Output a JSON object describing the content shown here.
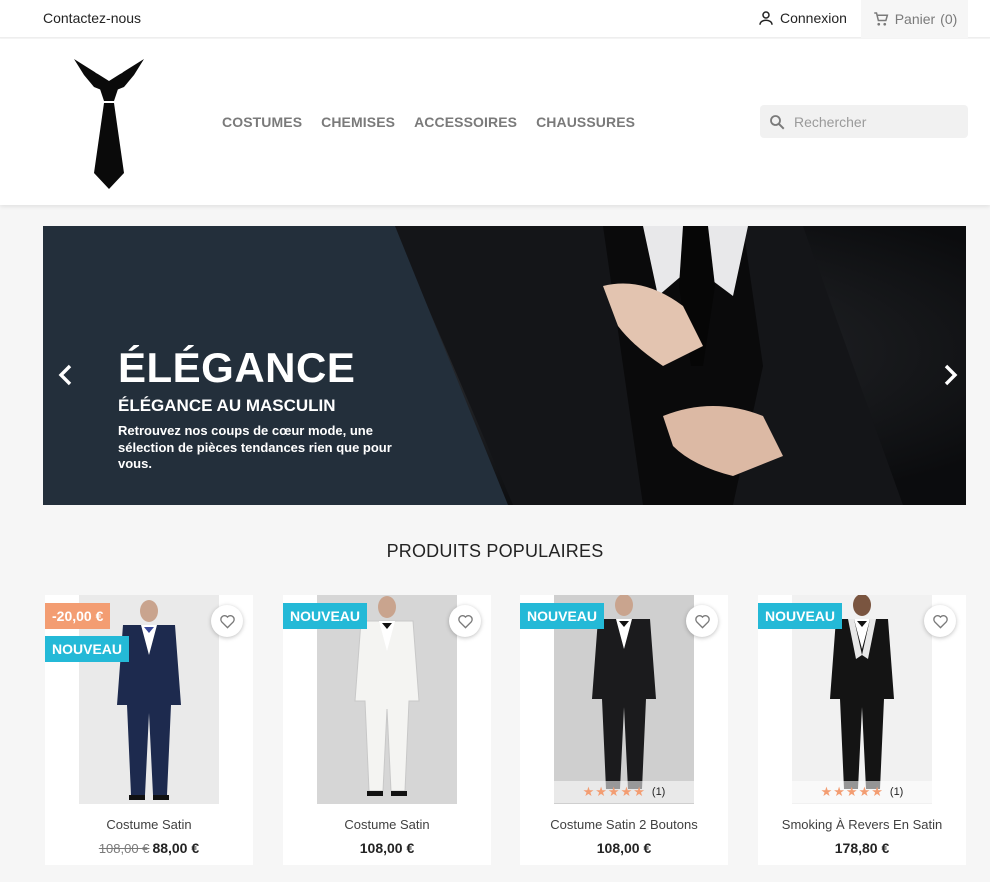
{
  "topbar": {
    "contact": "Contactez-nous",
    "login": "Connexion",
    "cart_label": "Panier",
    "cart_count": "(0)"
  },
  "nav": [
    "COSTUMES",
    "CHEMISES",
    "ACCESSOIRES",
    "CHAUSSURES"
  ],
  "search": {
    "placeholder": "Rechercher"
  },
  "slide": {
    "title": "ÉLÉGANCE",
    "subtitle": "ÉLÉGANCE AU MASCULIN",
    "text": "Retrouvez nos coups de cœur mode, une sélection de pièces tendances rien que pour vous."
  },
  "section_title": "PRODUITS POPULAIRES",
  "products": [
    {
      "name": "Costume Satin",
      "old_price": "108,00 €",
      "price": "88,00 €",
      "discount": "-20,00 €",
      "flag": "NOUVEAU",
      "suit_color": "#1d2a4e"
    },
    {
      "name": "Costume Satin",
      "price": "108,00 €",
      "flag": "NOUVEAU",
      "suit_color": "#f4f4f2"
    },
    {
      "name": "Costume Satin 2 Boutons",
      "price": "108,00 €",
      "flag": "NOUVEAU",
      "rating_count": "(1)",
      "suit_color": "#1b1b1d"
    },
    {
      "name": "Smoking À Revers En Satin",
      "price": "178,80 €",
      "flag": "NOUVEAU",
      "rating_count": "(1)",
      "suit_color": "#141414"
    }
  ],
  "colors": {
    "accent": "#24b9d7",
    "discount": "#f39d72",
    "slide_panel": "#232f3b"
  }
}
